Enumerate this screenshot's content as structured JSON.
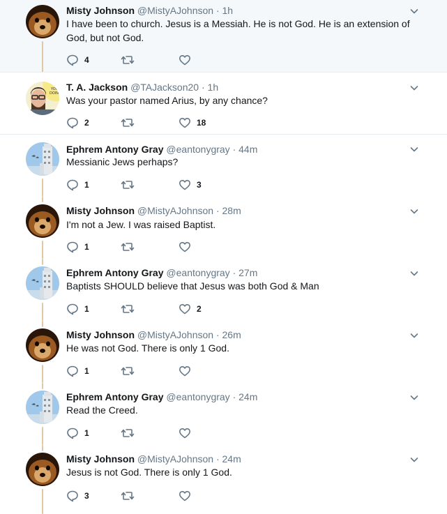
{
  "thread": {
    "tweets": [
      {
        "name": "Misty Johnson",
        "handle": "@MistyAJohnson",
        "time": "1h",
        "text": "I have been to church. Jesus is a Messiah. He is not God. He is an extension of God, but not God.",
        "replies": "4",
        "retweets": "",
        "likes": "",
        "avatar": "dog",
        "highlighted": true
      },
      {
        "name": "T. A. Jackson",
        "handle": "@TAJackson20",
        "time": "1h",
        "text": "Was your pastor named Arius, by any chance?",
        "replies": "2",
        "retweets": "",
        "likes": "18",
        "avatar": "comic"
      },
      {
        "name": "Ephrem Antony Gray",
        "handle": "@eantonygray",
        "time": "44m",
        "text": "Messianic Jews perhaps?",
        "replies": "1",
        "retweets": "",
        "likes": "3",
        "avatar": "tower"
      },
      {
        "name": "Misty Johnson",
        "handle": "@MistyAJohnson",
        "time": "28m",
        "text": "I'm not a Jew. I was raised Baptist.",
        "replies": "1",
        "retweets": "",
        "likes": "",
        "avatar": "dog"
      },
      {
        "name": "Ephrem Antony Gray",
        "handle": "@eantonygray",
        "time": "27m",
        "text": "Baptists SHOULD believe that Jesus was both God & Man",
        "replies": "1",
        "retweets": "",
        "likes": "2",
        "avatar": "tower"
      },
      {
        "name": "Misty Johnson",
        "handle": "@MistyAJohnson",
        "time": "26m",
        "text": "He was not God. There is only 1 God.",
        "replies": "1",
        "retweets": "",
        "likes": "",
        "avatar": "dog"
      },
      {
        "name": "Ephrem Antony Gray",
        "handle": "@eantonygray",
        "time": "24m",
        "text": "Read the Creed.",
        "replies": "1",
        "retweets": "",
        "likes": "",
        "avatar": "tower"
      },
      {
        "name": "Misty Johnson",
        "handle": "@MistyAJohnson",
        "time": "24m",
        "text": "Jesus is not God. There is only 1 God.",
        "replies": "3",
        "retweets": "",
        "likes": "",
        "avatar": "dog"
      }
    ],
    "separator": "·",
    "icons": {
      "reply": "reply-icon",
      "retweet": "retweet-icon",
      "like": "like-icon",
      "more": "chevron-down-icon"
    },
    "colors": {
      "icon": "#657786",
      "highlight_bg": "#f5f8fa",
      "connector": "#e3c7a3"
    }
  }
}
